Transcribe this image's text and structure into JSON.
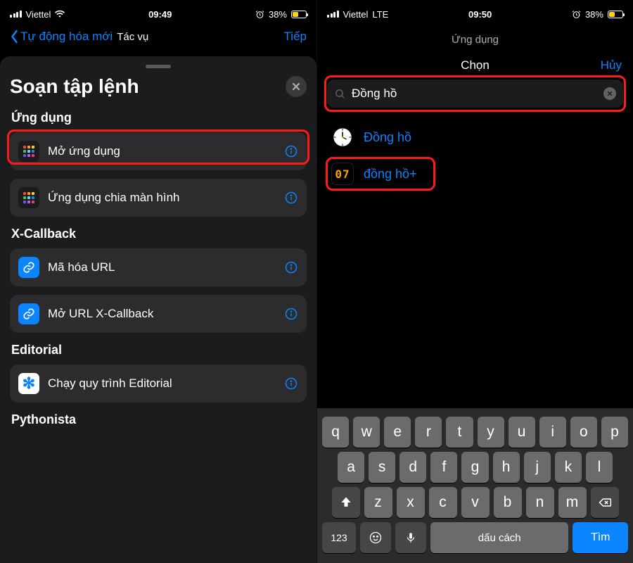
{
  "left": {
    "status": {
      "carrier": "Viettel",
      "net": "wifi",
      "time": "09:49",
      "battery_pct": "38%"
    },
    "nav": {
      "back": "Tự động hóa mới",
      "title": "Tác vụ",
      "next": "Tiếp"
    },
    "sheet_title": "Soạn tập lệnh",
    "groups": {
      "apps": {
        "label": "Ứng dụng",
        "open_app": "Mở ứng dụng",
        "split_screen": "Ứng dụng chia màn hình"
      },
      "xcallback": {
        "label": "X-Callback",
        "encode_url": "Mã hóa URL",
        "open_url": "Mở URL X-Callback"
      },
      "editorial": {
        "label": "Editorial",
        "run": "Chạy quy trình Editorial"
      },
      "pythonista": {
        "label": "Pythonista"
      }
    }
  },
  "right": {
    "status": {
      "carrier": "Viettel",
      "net": "LTE",
      "time": "09:50",
      "battery_pct": "38%"
    },
    "subtitle": "Ứng dụng",
    "title": "Chọn",
    "cancel": "Hủy",
    "search_value": "Đồng hồ",
    "results": {
      "clock": "Đồng hồ",
      "clock_plus": "đồng hồ+",
      "clock_plus_icon": "07"
    },
    "keyboard": {
      "r1": [
        "q",
        "w",
        "e",
        "r",
        "t",
        "y",
        "u",
        "i",
        "o",
        "p"
      ],
      "r2": [
        "a",
        "s",
        "d",
        "f",
        "g",
        "h",
        "j",
        "k",
        "l"
      ],
      "r3": [
        "z",
        "x",
        "c",
        "v",
        "b",
        "n",
        "m"
      ],
      "numkey": "123",
      "space": "dấu cách",
      "return": "Tìm"
    }
  }
}
